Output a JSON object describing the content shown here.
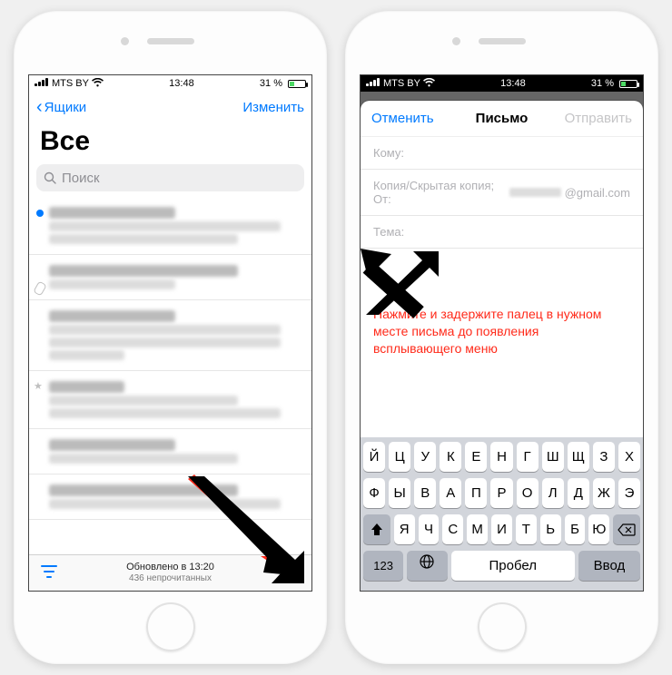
{
  "status": {
    "carrier": "MTS BY",
    "time": "13:48",
    "battery_text": "31 %"
  },
  "left": {
    "nav_back": "Ящики",
    "nav_edit": "Изменить",
    "title": "Все",
    "search_placeholder": "Поиск",
    "toolbar": {
      "updated": "Обновлено в 13:20",
      "unread": "436 непрочитанных"
    }
  },
  "right": {
    "cancel": "Отменить",
    "title": "Письмо",
    "send": "Отправить",
    "fields": {
      "to": "Кому:",
      "cc_from": "Копия/Скрытая копия; От:",
      "from_domain": "@gmail.com",
      "subject": "Тема:"
    },
    "instruction": "Нажмите и задержите палец в нужном месте письма до появления всплывающего меню",
    "keyboard": {
      "row1": [
        "Й",
        "Ц",
        "У",
        "К",
        "Е",
        "Н",
        "Г",
        "Ш",
        "Щ",
        "З",
        "Х"
      ],
      "row2": [
        "Ф",
        "Ы",
        "В",
        "А",
        "П",
        "Р",
        "О",
        "Л",
        "Д",
        "Ж",
        "Э"
      ],
      "row3": [
        "Я",
        "Ч",
        "С",
        "М",
        "И",
        "Т",
        "Ь",
        "Б",
        "Ю"
      ],
      "numkey": "123",
      "space": "Пробел",
      "return": "Ввод"
    }
  },
  "colors": {
    "blue": "#007aff",
    "red": "#ff2a1a"
  }
}
